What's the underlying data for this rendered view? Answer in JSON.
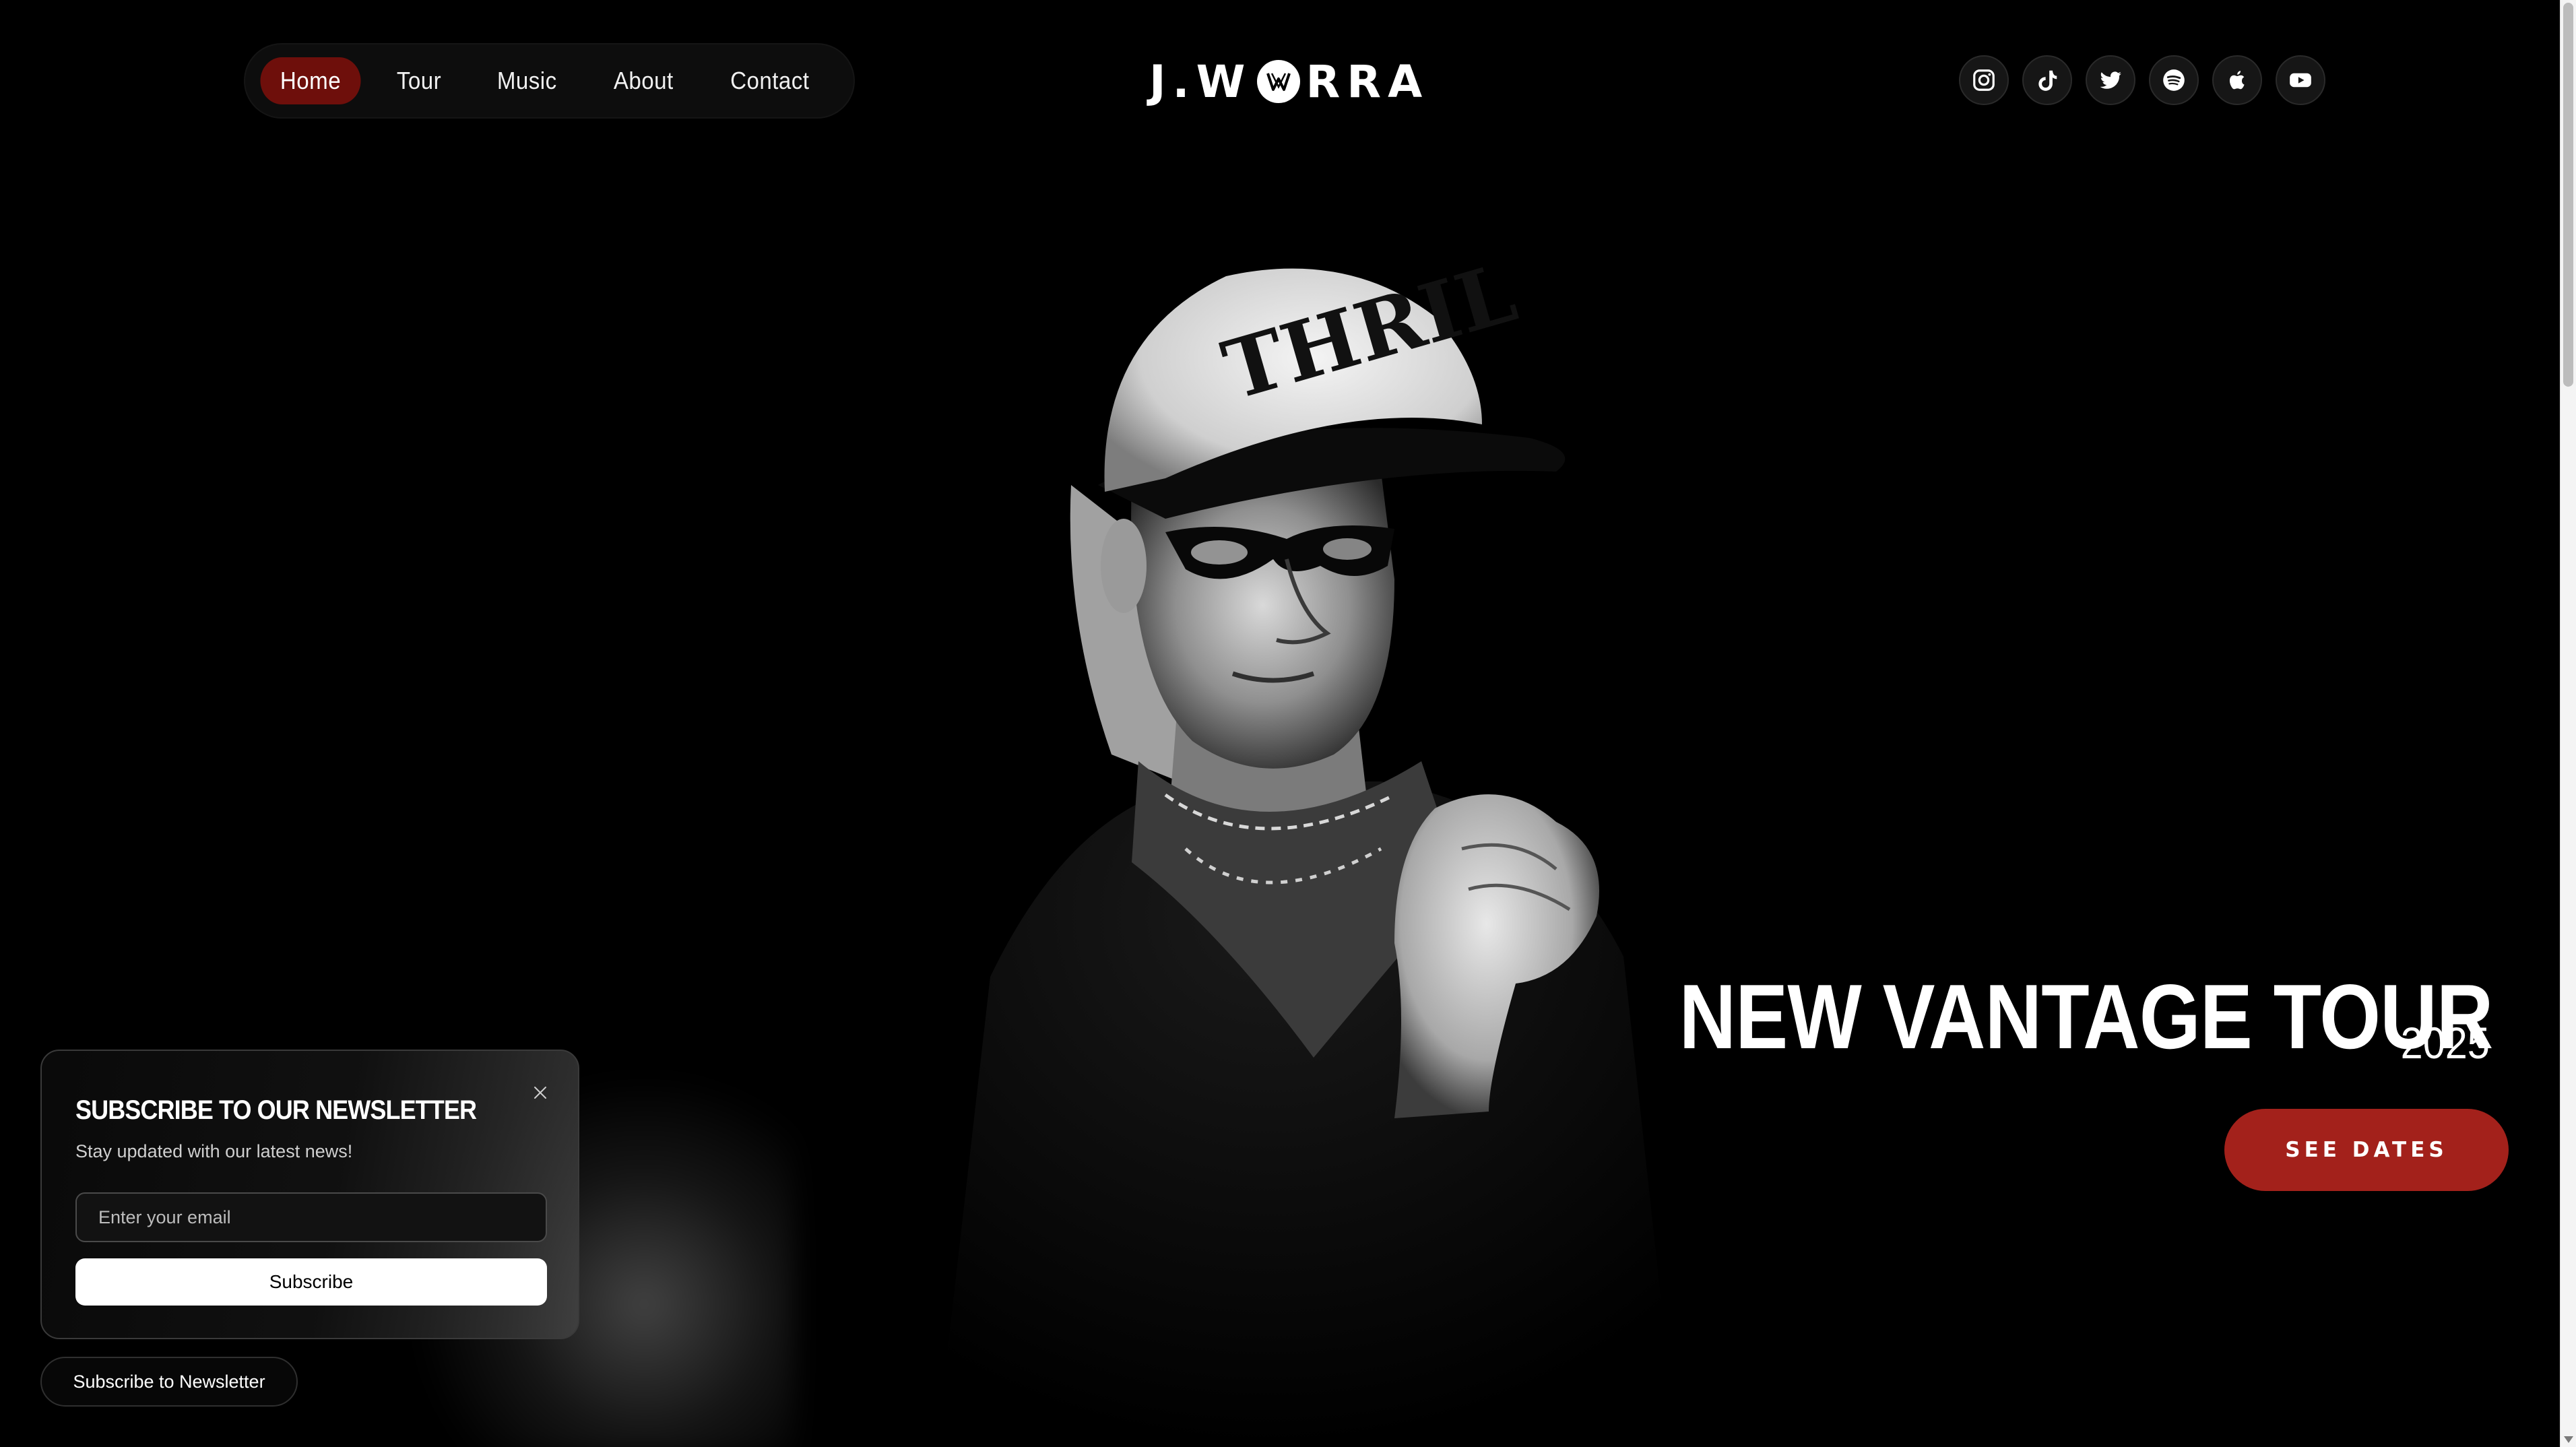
{
  "nav": {
    "items": [
      {
        "label": "Home",
        "active": true
      },
      {
        "label": "Tour",
        "active": false
      },
      {
        "label": "Music",
        "active": false
      },
      {
        "label": "About",
        "active": false
      },
      {
        "label": "Contact",
        "active": false
      }
    ]
  },
  "logo": {
    "left": "J.W",
    "right": "RRA"
  },
  "social": [
    {
      "icon": "instagram-icon"
    },
    {
      "icon": "tiktok-icon"
    },
    {
      "icon": "twitter-icon"
    },
    {
      "icon": "spotify-icon"
    },
    {
      "icon": "apple-music-icon"
    },
    {
      "icon": "youtube-icon"
    }
  ],
  "hero": {
    "title": "NEW VANTAGE TOUR",
    "year": "2025",
    "cta_label": "SEE DATES",
    "cap_text": "THRIL"
  },
  "newsletter": {
    "title": "SUBSCRIBE TO OUR NEWSLETTER",
    "subtitle": "Stay updated with our latest news!",
    "email_placeholder": "Enter your email",
    "submit_label": "Subscribe",
    "toggle_label": "Subscribe to Newsletter"
  },
  "colors": {
    "accent": "#a3211b",
    "nav_active": "#6e0f0b",
    "background": "#000000"
  }
}
